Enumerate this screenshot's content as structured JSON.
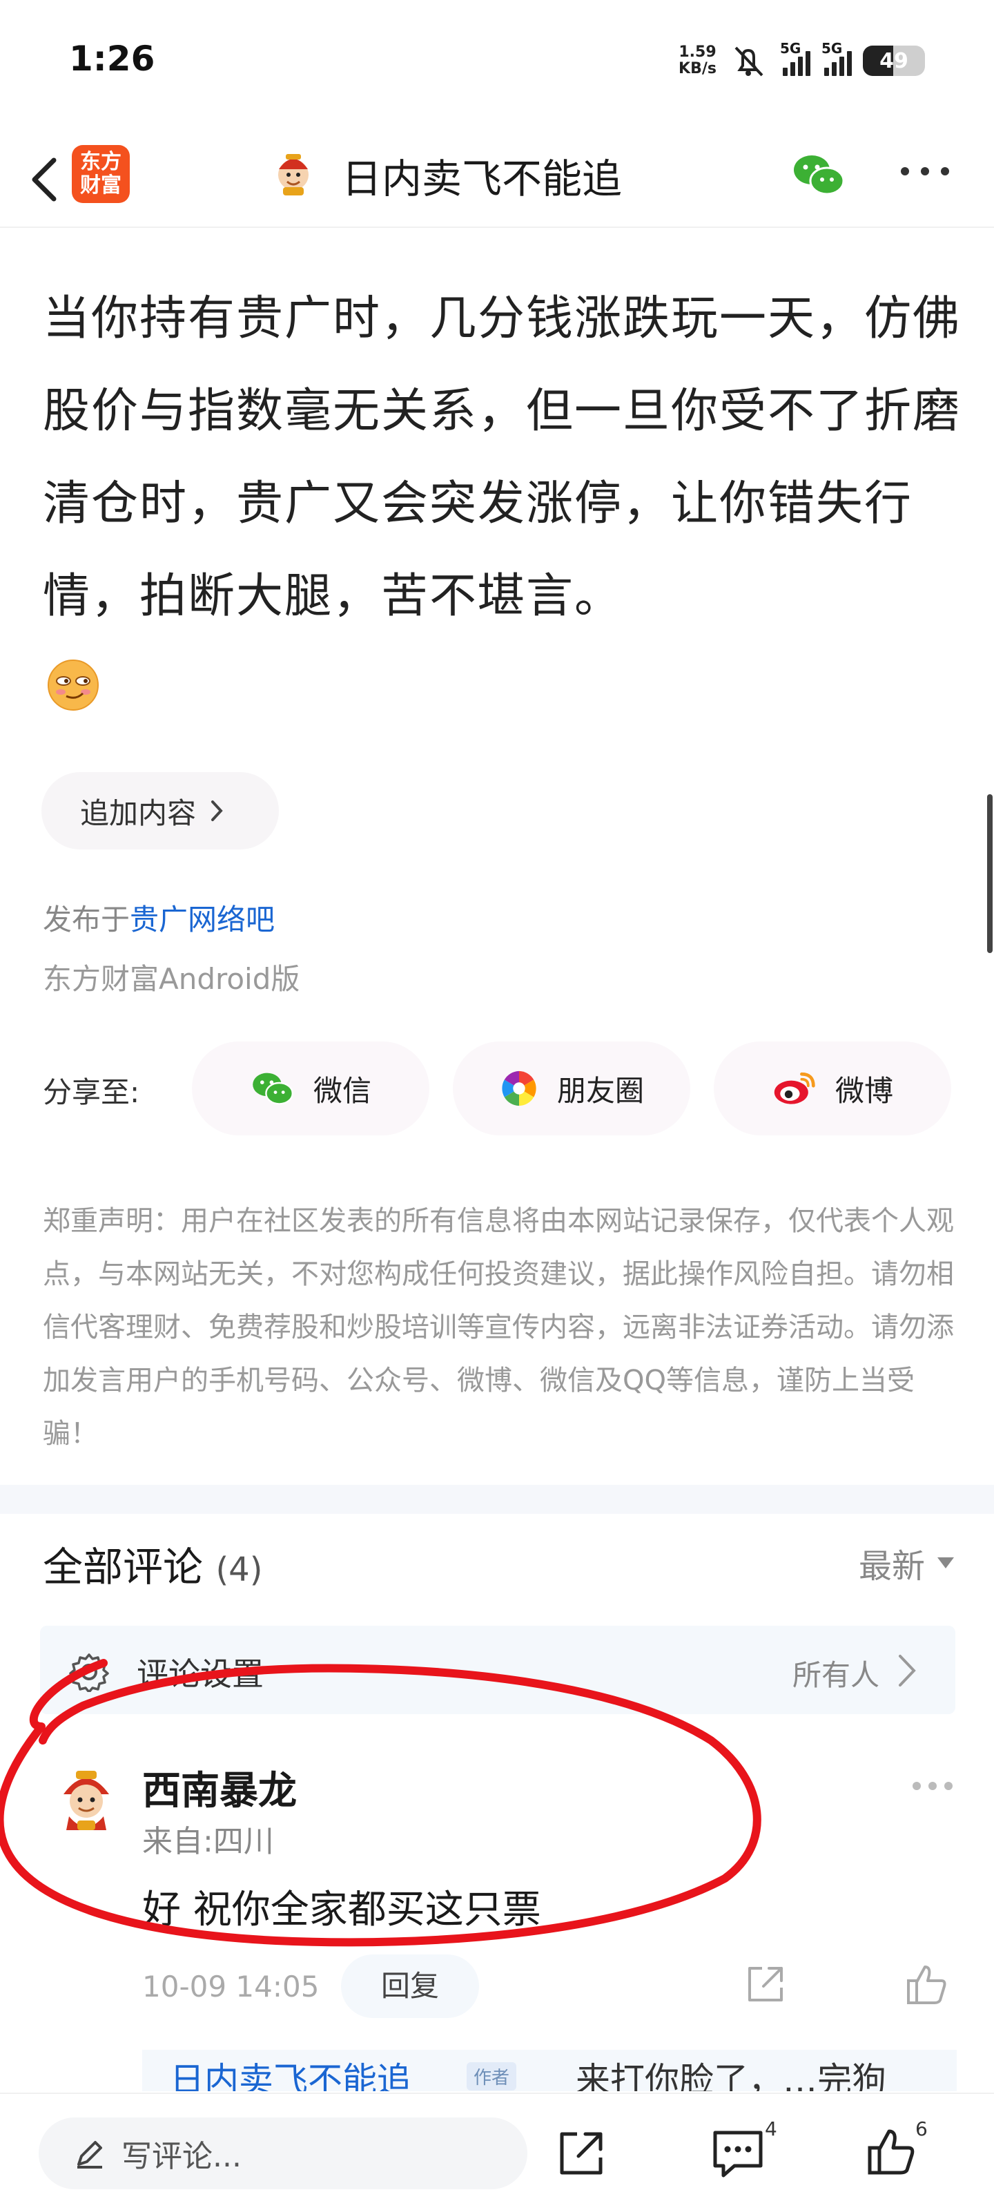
{
  "status_bar": {
    "time": "1:26",
    "net_speed_value": "1.59",
    "net_speed_unit": "KB/s",
    "signal_1_label": "5G",
    "signal_2_label": "5G",
    "battery": "49",
    "battery_level": 0.49
  },
  "nav": {
    "brand_logo_text": "东方财富",
    "title": "日内卖飞不能追"
  },
  "post": {
    "body": "当你持有贵广时，几分钱涨跌玩一天，仿佛股价与指数毫无关系，但一旦你受不了折磨清仓时，贵广又会突发涨停，让你错失行情，拍断大腿，苦不堪言。",
    "add_content_label": "追加内容",
    "published_prefix": "发布于",
    "published_forum": "贵广网络吧",
    "client_label": "东方财富Android版"
  },
  "share": {
    "label": "分享至:",
    "targets": [
      {
        "label": "微信",
        "icon": "wechat-icon"
      },
      {
        "label": "朋友圈",
        "icon": "moments-icon"
      },
      {
        "label": "微博",
        "icon": "weibo-icon"
      }
    ]
  },
  "disclaimer": "郑重声明：用户在社区发表的所有信息将由本网站记录保存，仅代表个人观点，与本网站无关，不对您构成任何投资建议，据此操作风险自担。请勿相信代客理财、免费荐股和炒股培训等宣传内容，远离非法证券活动。请勿添加发言用户的手机号码、公众号、微博、微信及QQ等信息，谨防上当受骗！",
  "comments": {
    "title": "全部评论",
    "count": "(4)",
    "sort_label": "最新",
    "settings_label": "评论设置",
    "settings_value": "所有人",
    "items": [
      {
        "user": "西南暴龙",
        "location": "来自:四川",
        "text": "好 祝你全家都买这只票",
        "time": "10-09 14:05",
        "reply_label": "回复",
        "sub_reply_user": "日内卖飞不能追",
        "sub_reply_badge": "作者",
        "sub_reply_text": "来打你脸了，…完狗"
      }
    ]
  },
  "bottom_bar": {
    "write_placeholder": "写评论...",
    "comment_count": "4",
    "like_count": "6"
  },
  "colors": {
    "link_blue": "#1a66d2",
    "brand_orange": "#f4511e",
    "annotation_red": "#e8141b",
    "wechat_green": "#3cb034"
  }
}
